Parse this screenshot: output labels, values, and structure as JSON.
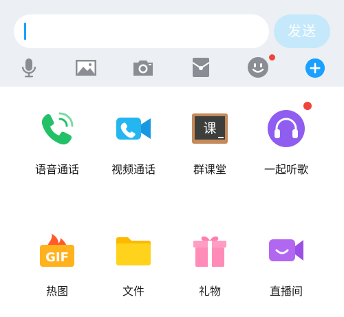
{
  "input": {
    "value": ""
  },
  "send_label": "发送",
  "toolbar": {
    "icons": [
      "microphone-icon",
      "image-icon",
      "camera-icon",
      "red-packet-icon",
      "emoji-icon",
      "plus-icon"
    ],
    "emoji_has_badge": true
  },
  "features": [
    {
      "label": "语音通话",
      "icon": "phone-call-icon"
    },
    {
      "label": "视频通话",
      "icon": "video-call-icon"
    },
    {
      "label": "群课堂",
      "icon": "group-class-icon"
    },
    {
      "label": "一起听歌",
      "icon": "headphones-icon",
      "badge": true
    },
    {
      "label": "热图",
      "icon": "gif-icon"
    },
    {
      "label": "文件",
      "icon": "folder-icon"
    },
    {
      "label": "礼物",
      "icon": "gift-icon"
    },
    {
      "label": "直播间",
      "icon": "live-room-icon"
    }
  ],
  "colors": {
    "accent": "#1aa0ff",
    "send_button": "#c5e9fb",
    "toolbar_bg": "#eceff4",
    "badge": "#f0433a",
    "icon_gray": "#8a8e94"
  },
  "group_class_glyph": "课"
}
